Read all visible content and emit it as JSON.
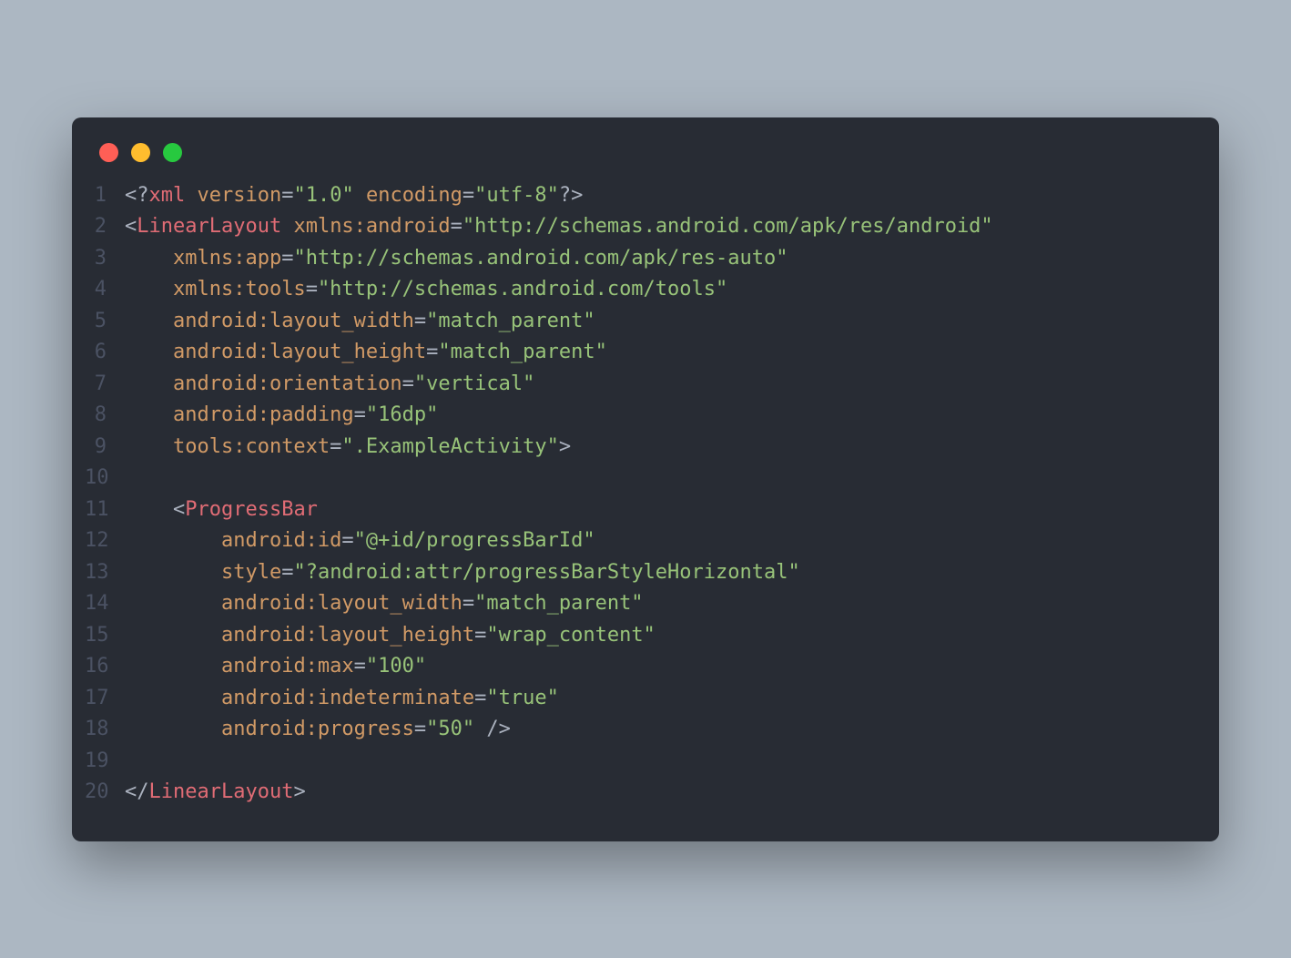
{
  "colors": {
    "page_bg": "#acb7c2",
    "window_bg": "#282c34",
    "gutter_fg": "#4b5263",
    "default_fg": "#abb2bf",
    "tag_fg": "#e06c75",
    "attr_fg": "#d19a66",
    "string_fg": "#98c379",
    "keyword_fg": "#c678dd",
    "traffic_red": "#ff5f56",
    "traffic_yellow": "#ffbd2e",
    "traffic_green": "#27c93f"
  },
  "gutter": [
    "1",
    "2",
    "3",
    "4",
    "5",
    "6",
    "7",
    "8",
    "9",
    "10",
    "11",
    "12",
    "13",
    "14",
    "15",
    "16",
    "17",
    "18",
    "19",
    "20"
  ],
  "code_lines": [
    [
      {
        "cls": "punct",
        "t": "<?"
      },
      {
        "cls": "tag",
        "t": "xml"
      },
      {
        "cls": "punct",
        "t": " "
      },
      {
        "cls": "attr",
        "t": "version"
      },
      {
        "cls": "punct",
        "t": "="
      },
      {
        "cls": "str",
        "t": "\"1.0\""
      },
      {
        "cls": "punct",
        "t": " "
      },
      {
        "cls": "attr",
        "t": "encoding"
      },
      {
        "cls": "punct",
        "t": "="
      },
      {
        "cls": "str",
        "t": "\"utf-8\""
      },
      {
        "cls": "punct",
        "t": "?>"
      }
    ],
    [
      {
        "cls": "punct",
        "t": "<"
      },
      {
        "cls": "tag",
        "t": "LinearLayout"
      },
      {
        "cls": "punct",
        "t": " "
      },
      {
        "cls": "attr",
        "t": "xmlns:android"
      },
      {
        "cls": "punct",
        "t": "="
      },
      {
        "cls": "str",
        "t": "\"http://schemas.android.com/apk/res/android\""
      }
    ],
    [
      {
        "cls": "punct",
        "t": "    "
      },
      {
        "cls": "attr",
        "t": "xmlns:app"
      },
      {
        "cls": "punct",
        "t": "="
      },
      {
        "cls": "str",
        "t": "\"http://schemas.android.com/apk/res-auto\""
      }
    ],
    [
      {
        "cls": "punct",
        "t": "    "
      },
      {
        "cls": "attr",
        "t": "xmlns:tools"
      },
      {
        "cls": "punct",
        "t": "="
      },
      {
        "cls": "str",
        "t": "\"http://schemas.android.com/tools\""
      }
    ],
    [
      {
        "cls": "punct",
        "t": "    "
      },
      {
        "cls": "attr",
        "t": "android:layout_width"
      },
      {
        "cls": "punct",
        "t": "="
      },
      {
        "cls": "str",
        "t": "\"match_parent\""
      }
    ],
    [
      {
        "cls": "punct",
        "t": "    "
      },
      {
        "cls": "attr",
        "t": "android:layout_height"
      },
      {
        "cls": "punct",
        "t": "="
      },
      {
        "cls": "str",
        "t": "\"match_parent\""
      }
    ],
    [
      {
        "cls": "punct",
        "t": "    "
      },
      {
        "cls": "attr",
        "t": "android:orientation"
      },
      {
        "cls": "punct",
        "t": "="
      },
      {
        "cls": "str",
        "t": "\"vertical\""
      }
    ],
    [
      {
        "cls": "punct",
        "t": "    "
      },
      {
        "cls": "attr",
        "t": "android:padding"
      },
      {
        "cls": "punct",
        "t": "="
      },
      {
        "cls": "str",
        "t": "\"16dp\""
      }
    ],
    [
      {
        "cls": "punct",
        "t": "    "
      },
      {
        "cls": "attr",
        "t": "tools:context"
      },
      {
        "cls": "punct",
        "t": "="
      },
      {
        "cls": "str",
        "t": "\".ExampleActivity\""
      },
      {
        "cls": "punct",
        "t": ">"
      }
    ],
    [],
    [
      {
        "cls": "punct",
        "t": "    <"
      },
      {
        "cls": "tag",
        "t": "ProgressBar"
      }
    ],
    [
      {
        "cls": "punct",
        "t": "        "
      },
      {
        "cls": "attr",
        "t": "android:id"
      },
      {
        "cls": "punct",
        "t": "="
      },
      {
        "cls": "str",
        "t": "\"@+id/progressBarId\""
      }
    ],
    [
      {
        "cls": "punct",
        "t": "        "
      },
      {
        "cls": "attr",
        "t": "style"
      },
      {
        "cls": "punct",
        "t": "="
      },
      {
        "cls": "str",
        "t": "\"?android:attr/progressBarStyleHorizontal\""
      }
    ],
    [
      {
        "cls": "punct",
        "t": "        "
      },
      {
        "cls": "attr",
        "t": "android:layout_width"
      },
      {
        "cls": "punct",
        "t": "="
      },
      {
        "cls": "str",
        "t": "\"match_parent\""
      }
    ],
    [
      {
        "cls": "punct",
        "t": "        "
      },
      {
        "cls": "attr",
        "t": "android:layout_height"
      },
      {
        "cls": "punct",
        "t": "="
      },
      {
        "cls": "str",
        "t": "\"wrap_content\""
      }
    ],
    [
      {
        "cls": "punct",
        "t": "        "
      },
      {
        "cls": "attr",
        "t": "android:max"
      },
      {
        "cls": "punct",
        "t": "="
      },
      {
        "cls": "str",
        "t": "\"100\""
      }
    ],
    [
      {
        "cls": "punct",
        "t": "        "
      },
      {
        "cls": "attr",
        "t": "android:indeterminate"
      },
      {
        "cls": "punct",
        "t": "="
      },
      {
        "cls": "str",
        "t": "\"true\""
      }
    ],
    [
      {
        "cls": "punct",
        "t": "        "
      },
      {
        "cls": "attr",
        "t": "android:progress"
      },
      {
        "cls": "punct",
        "t": "="
      },
      {
        "cls": "str",
        "t": "\"50\""
      },
      {
        "cls": "punct",
        "t": " />"
      }
    ],
    [],
    [
      {
        "cls": "punct",
        "t": "</"
      },
      {
        "cls": "tag",
        "t": "LinearLayout"
      },
      {
        "cls": "punct",
        "t": ">"
      }
    ]
  ]
}
